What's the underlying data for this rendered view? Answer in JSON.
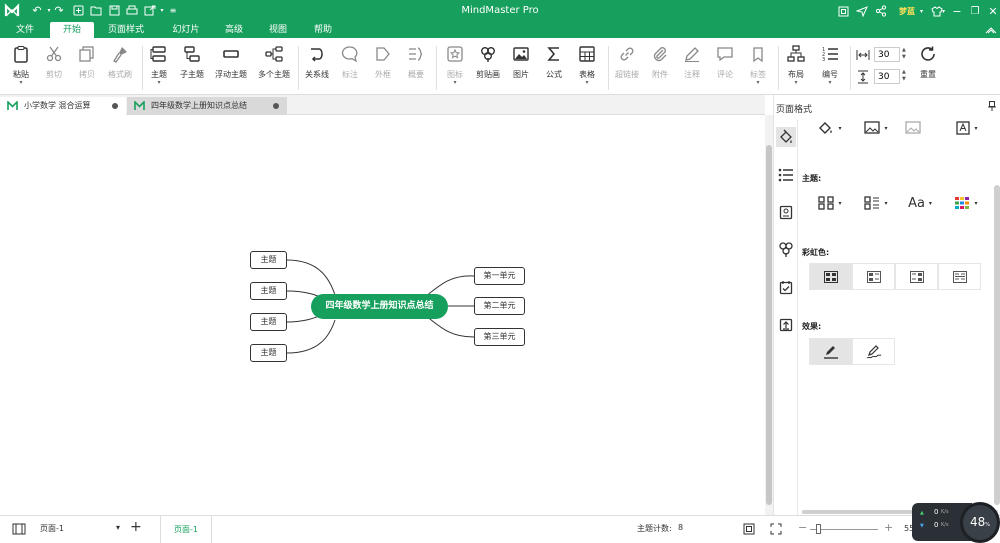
{
  "titlebar": {
    "title": "MindMaster Pro",
    "user": "梦蓝"
  },
  "menu": {
    "file": "文件",
    "start": "开始",
    "page_style": "页面样式",
    "slideshow": "幻灯片",
    "advanced": "高级",
    "view": "视图",
    "help": "帮助"
  },
  "ribbon": {
    "paste": "粘贴",
    "cut": "剪切",
    "copy": "拷贝",
    "format_painter": "格式刷",
    "topic": "主题",
    "subtopic": "子主题",
    "floating_topic": "浮动主题",
    "multi_topic": "多个主题",
    "relationship": "关系线",
    "callout": "标注",
    "boundary": "外框",
    "summary": "概要",
    "mark": "图标",
    "clipart": "剪贴画",
    "picture": "图片",
    "formula": "公式",
    "table": "表格",
    "hyperlink": "超链接",
    "attachment": "附件",
    "note": "注释",
    "comment": "评论",
    "tag": "标签",
    "layout": "布局",
    "numbering": "编号",
    "spacing_h": "30",
    "spacing_v": "30",
    "reset": "重置"
  },
  "doctabs": [
    {
      "label": "小学数学 混合运算"
    },
    {
      "label": "四年级数学上册知识点总结"
    }
  ],
  "mindmap": {
    "root": "四年级数学上册知识点总结",
    "left": [
      "主题",
      "主题",
      "主题",
      "主题"
    ],
    "right": [
      "第一单元",
      "第二单元",
      "第三单元"
    ]
  },
  "panel": {
    "title": "页面格式",
    "theme_label": "主题:",
    "rainbow_label": "彩虹色:",
    "effect_label": "效果:"
  },
  "status": {
    "page_select": "页面-1",
    "page_tab": "页面-1",
    "topic_count_label": "主题计数:",
    "topic_count": "8",
    "zoom": "55",
    "speed_up": "0",
    "speed_down": "0",
    "speed_unit": "K/s",
    "cpu": "48"
  },
  "colors": {
    "brand": "#17a05d"
  }
}
